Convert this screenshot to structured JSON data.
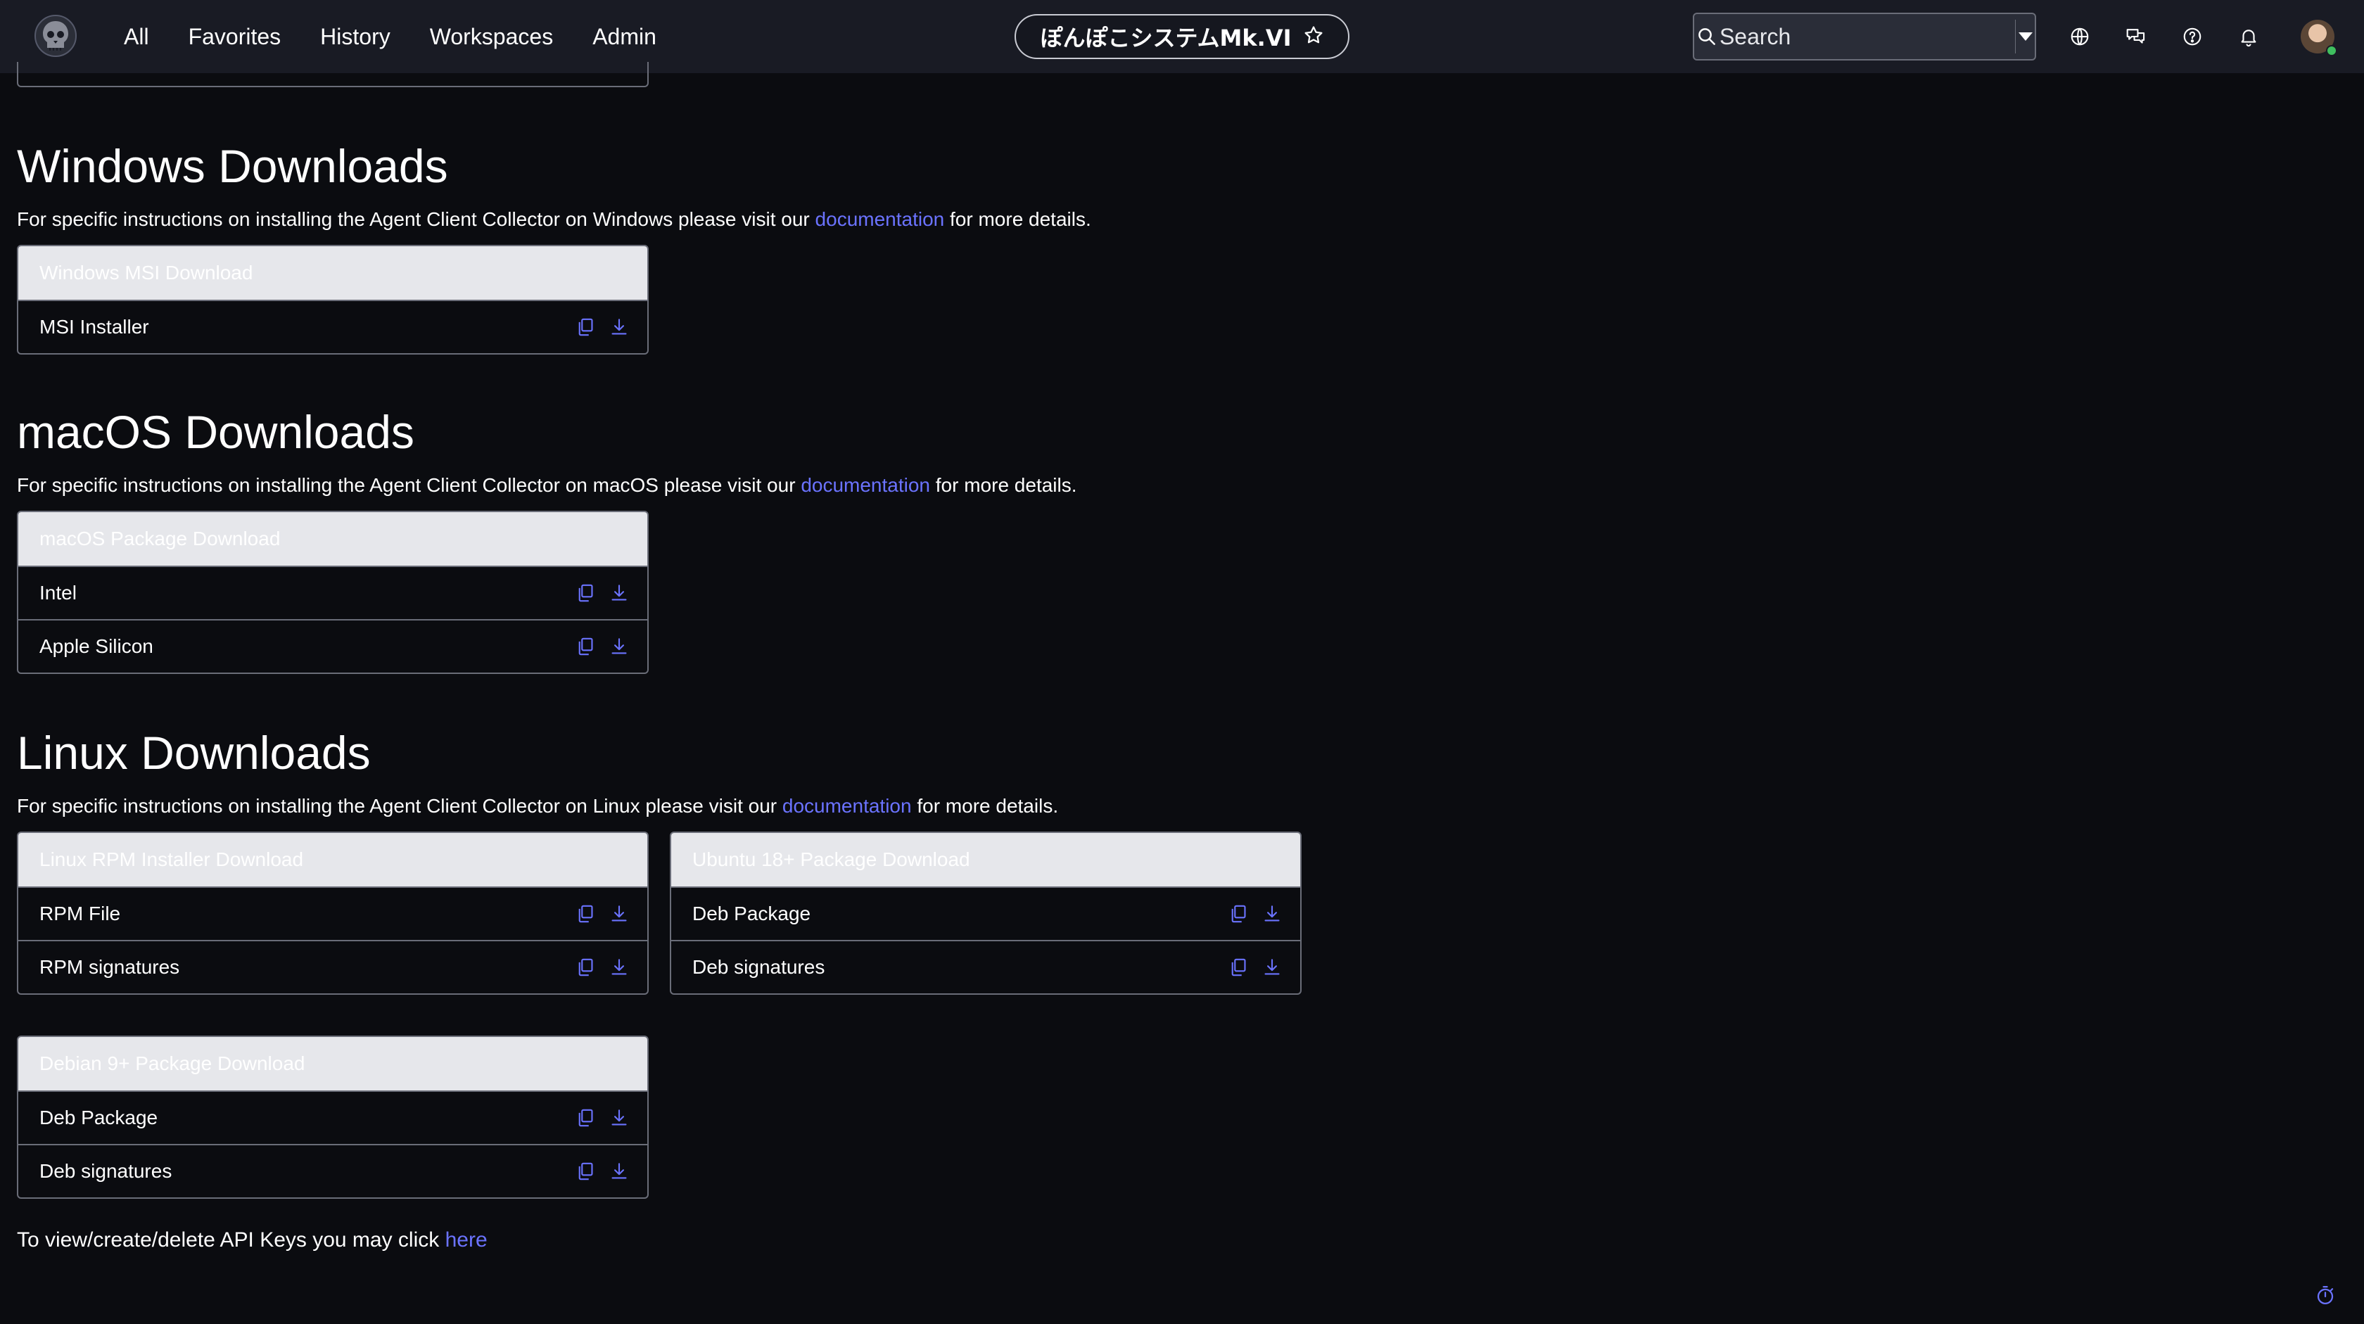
{
  "nav": {
    "items": [
      "All",
      "Favorites",
      "History",
      "Workspaces",
      "Admin"
    ]
  },
  "instance": {
    "name": "ぽんぽこシステムMk.VI"
  },
  "search": {
    "placeholder": "Search"
  },
  "icons": {
    "logo": "skull-logo-icon",
    "favorite": "star-icon",
    "search": "search-icon",
    "dropdown": "caret-down-icon",
    "language": "globe-icon",
    "chat": "chat-icon",
    "help": "help-icon",
    "notifications": "bell-icon",
    "copy": "copy-icon",
    "download": "download-icon",
    "timer": "stopwatch-icon"
  },
  "colors": {
    "background": "#0b0c10",
    "topbar": "#191b24",
    "link": "#6b73ff",
    "card_header": "#e6e7eb",
    "border": "#6a6d78",
    "status_online": "#3fbf5f"
  },
  "windows": {
    "title": "Windows Downloads",
    "desc_before": "For specific instructions on installing the Agent Client Collector on Windows please visit our ",
    "desc_link": "documentation",
    "desc_after": " for more details.",
    "card": {
      "header": "Windows MSI Download",
      "rows": [
        "MSI Installer"
      ]
    }
  },
  "macos": {
    "title": "macOS Downloads",
    "desc_before": "For specific instructions on installing the Agent Client Collector on macOS please visit our ",
    "desc_link": "documentation",
    "desc_after": " for more details.",
    "card": {
      "header": "macOS Package Download",
      "rows": [
        "Intel",
        "Apple Silicon"
      ]
    }
  },
  "linux": {
    "title": "Linux Downloads",
    "desc_before": "For specific instructions on installing the Agent Client Collector on Linux please visit our ",
    "desc_link": "documentation",
    "desc_after": " for more details.",
    "rpm": {
      "header": "Linux RPM Installer Download",
      "rows": [
        "RPM File",
        "RPM signatures"
      ]
    },
    "ubuntu": {
      "header": "Ubuntu 18+ Package Download",
      "rows": [
        "Deb Package",
        "Deb signatures"
      ]
    },
    "debian": {
      "header": "Debian 9+ Package Download",
      "rows": [
        "Deb Package",
        "Deb signatures"
      ]
    }
  },
  "footer": {
    "text": "To view/create/delete API Keys you may click ",
    "link": "here"
  }
}
